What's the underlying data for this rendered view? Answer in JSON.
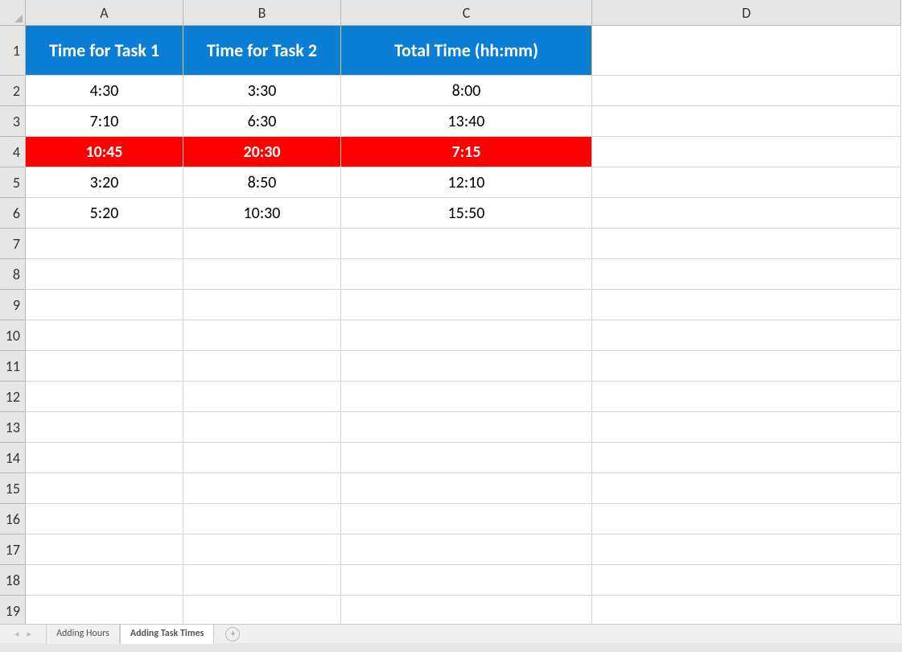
{
  "columns": [
    "A",
    "B",
    "C",
    "D"
  ],
  "rowCount": 19,
  "headers": {
    "A": "Time for Task 1",
    "B": "Time for Task 2",
    "C": "Total Time (hh:mm)"
  },
  "rows": [
    {
      "A": "4:30",
      "B": "3:30",
      "C": "8:00",
      "highlight": false
    },
    {
      "A": "7:10",
      "B": "6:30",
      "C": "13:40",
      "highlight": false
    },
    {
      "A": "10:45",
      "B": "20:30",
      "C": "7:15",
      "highlight": true
    },
    {
      "A": "3:20",
      "B": "8:50",
      "C": "12:10",
      "highlight": false
    },
    {
      "A": "5:20",
      "B": "10:30",
      "C": "15:50",
      "highlight": false
    }
  ],
  "tabs": [
    {
      "label": "Adding Hours",
      "active": false
    },
    {
      "label": "Adding Task Times",
      "active": true
    }
  ]
}
